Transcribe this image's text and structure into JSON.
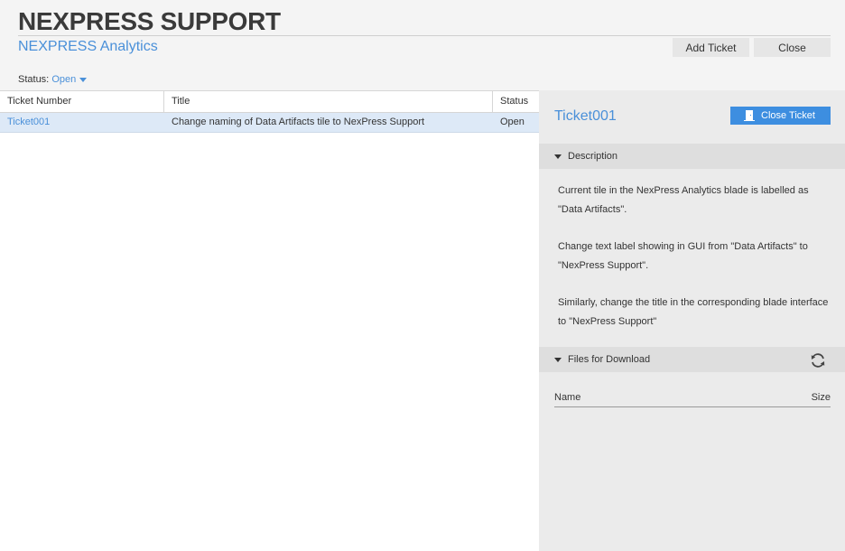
{
  "header": {
    "title": "NEXPRESS SUPPORT",
    "subtitle": "NEXPRESS Analytics",
    "add_ticket_label": "Add Ticket",
    "close_label": "Close",
    "status_label": "Status:",
    "status_value": "Open"
  },
  "table": {
    "columns": [
      "Ticket Number",
      "Title",
      "Status"
    ],
    "rows": [
      {
        "ticket": "Ticket001",
        "title": "Change naming of Data Artifacts tile to NexPress Support",
        "status": "Open"
      }
    ]
  },
  "detail": {
    "ticket_title": "Ticket001",
    "close_ticket_label": "Close Ticket",
    "description_header": "Description",
    "description_paragraphs": [
      "Current tile in the NexPress Analytics blade is labelled as \"Data Artifacts\".",
      "Change text label showing in GUI from \"Data Artifacts\" to \"NexPress Support\".",
      "Similarly, change the title in the corresponding blade interface to \"NexPress Support\""
    ],
    "files_header": "Files for Download",
    "files_columns": [
      "Name",
      "Size"
    ]
  },
  "colors": {
    "accent": "#4a90d9",
    "button_primary": "#3d8ee0",
    "selected_row": "#dde9f7"
  },
  "icons": [
    "caret-down-icon",
    "door-exit-icon",
    "triangle-down-icon",
    "refresh-icon"
  ]
}
